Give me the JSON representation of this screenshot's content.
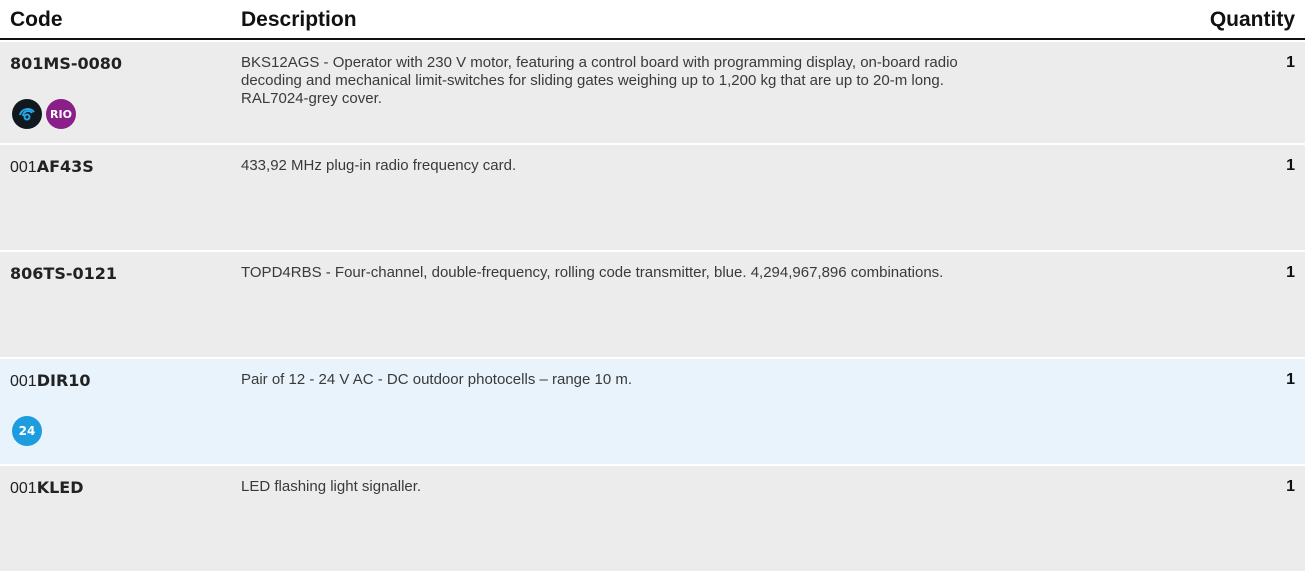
{
  "header": {
    "code": "Code",
    "description": "Description",
    "quantity": "Quantity"
  },
  "rows": [
    {
      "code_prefix": "",
      "code_main": "801MS-0080",
      "description": "BKS12AGS - Operator with 230 V motor, featuring a control board with programming display, on-board radio decoding and mechanical limit-switches for sliding gates weighing up to 1,200 kg that are up to 20-m long. RAL7024-grey cover.",
      "quantity": "1",
      "badges": [
        "wifi-icon",
        "RIO"
      ]
    },
    {
      "code_prefix": "001",
      "code_main": "AF43S",
      "description": "433,92 MHz plug-in radio frequency card.",
      "quantity": "1"
    },
    {
      "code_prefix": "",
      "code_main": "806TS-0121",
      "description": "TOPD4RBS - Four-channel, double-frequency, rolling code transmitter, blue. 4,294,967,896 combinations.",
      "quantity": "1"
    },
    {
      "code_prefix": "001",
      "code_main": "DIR10",
      "description": "Pair of 12 - 24 V AC - DC  outdoor photocells – range 10 m.",
      "quantity": "1",
      "badges": [
        "24"
      ]
    },
    {
      "code_prefix": "001",
      "code_main": "KLED",
      "description": "LED flashing light signaller.",
      "quantity": "1"
    }
  ],
  "colors": {
    "row_bg": "#ececec",
    "row_bg_highlight": "#e8f3fc",
    "rio_badge": "#8a1f8a",
    "voltage_badge": "#1e9ce0"
  }
}
